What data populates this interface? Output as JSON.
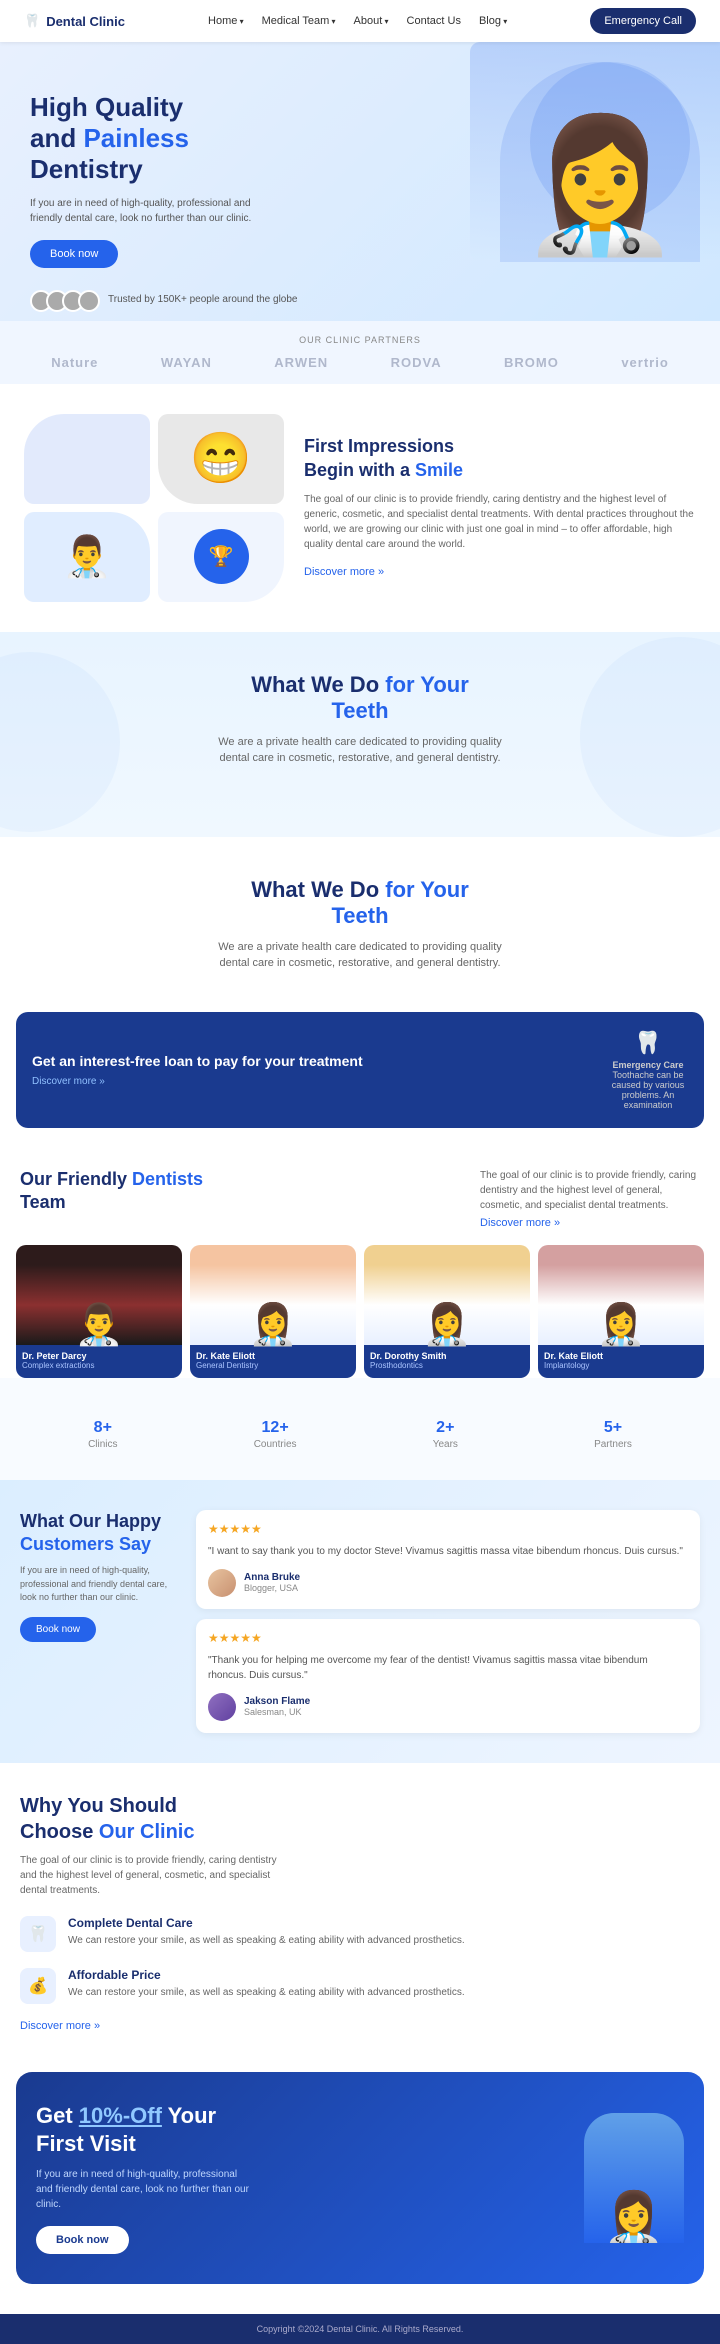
{
  "nav": {
    "logo": "Dental Clinic",
    "links": [
      "Home",
      "Medical Team",
      "About",
      "Contact Us",
      "Blog"
    ],
    "emergency": "Emergency Call"
  },
  "hero": {
    "title_line1": "High Quality",
    "title_line2": "and ",
    "title_highlight": "Painless",
    "title_line3": "Dentistry",
    "description": "If you are in need of high-quality, professional and friendly dental care, look no further than our clinic.",
    "book_btn": "Book now",
    "trusted_text": "Trusted by 150K+ people around the globe"
  },
  "partners": {
    "label": "OUR CLINIC PARTNERS",
    "logos": [
      "Nature",
      "WAYAN",
      "ARWEN",
      "RODVA",
      "BROMO",
      "vertrio"
    ]
  },
  "first_impressions": {
    "title_line1": "First Impressions",
    "title_line2": "Begin with a ",
    "title_highlight": "Smile",
    "description": "The goal of our clinic is to provide friendly, caring dentistry and the highest level of generic, cosmetic, and specialist dental treatments. With dental practices throughout the world, we are growing our clinic with just one goal in mind – to offer affordable, high quality dental care around the world.",
    "discover": "Discover more"
  },
  "what_we_do_1": {
    "title_line1": "What We Do ",
    "title_highlight1": "for Your",
    "title_line2": "Teeth",
    "description": "We are a private health care dedicated to providing quality dental care in cosmetic, restorative, and general dentistry."
  },
  "what_we_do_2": {
    "title_line1": "What We Do ",
    "title_highlight1": "for Your",
    "title_line2": "Teeth",
    "description": "We are a private health care dedicated to providing quality dental care in cosmetic, restorative, and general dentistry."
  },
  "loan": {
    "title": "Get an interest-free loan to pay for your treatment",
    "discover": "Discover more",
    "emergency_label": "Emergency Care",
    "emergency_desc": "Toothache can be caused by various problems. An examination"
  },
  "team": {
    "title_line1": "Our Friendly ",
    "title_highlight": "Dentists",
    "title_line2": "Team",
    "description": "The goal of our clinic is to provide friendly, caring dentistry and the highest level of general, cosmetic, and specialist dental treatments.",
    "discover": "Discover more",
    "doctors": [
      {
        "name": "Dr. Peter Darcy",
        "role": "Complex extractions"
      },
      {
        "name": "Dr. Kate Eliott",
        "role": "General Dentistry"
      },
      {
        "name": "Dr. Dorothy Smith",
        "role": "Prosthodontics"
      },
      {
        "name": "Dr. Kate Eliott",
        "role": "Implantology"
      }
    ]
  },
  "stats": [
    {
      "number": "8",
      "suffix": "+",
      "label": "Clinics"
    },
    {
      "number": "12",
      "suffix": "+",
      "label": "Countries"
    },
    {
      "number": "2",
      "suffix": "+",
      "label": "Years"
    },
    {
      "number": "5",
      "suffix": "+",
      "label": "Partners"
    }
  ],
  "testimonials": {
    "title_line1": "What Our Happy",
    "title_highlight": "Customers Say",
    "description": "If you are in need of high-quality, professional and friendly dental care, look no further than our clinic.",
    "book_btn": "Book now",
    "reviews": [
      {
        "stars": "★★★★★",
        "text": "\"I want to say thank you to my doctor Steve! Vivamus sagittis massa vitae bibendum rhoncus. Duis cursus.\"",
        "author": "Anna Bruke",
        "role": "Blogger, USA"
      },
      {
        "stars": "★★★★★",
        "text": "\"Thank you for helping me overcome my fear of the dentist! Vivamus sagittis massa vitae bibendum rhoncus. Duis cursus.\"",
        "author": "Jakson Flame",
        "role": "Salesman, UK"
      }
    ]
  },
  "why_choose": {
    "title_line1": "Why You Should",
    "title_line2": "Choose ",
    "title_highlight": "Our Clinic",
    "description": "The goal of our clinic is to provide friendly, caring dentistry and the highest level of general, cosmetic, and specialist dental treatments.",
    "items": [
      {
        "icon": "🦷",
        "title": "Complete Dental Care",
        "description": "We can restore your smile, as well as speaking & eating ability with advanced prosthetics."
      },
      {
        "icon": "💰",
        "title": "Affordable Price",
        "description": "We can restore your smile, as well as speaking & eating ability with advanced prosthetics."
      }
    ],
    "discover": "Discover more"
  },
  "cta": {
    "title_line1": "Get ",
    "title_highlight": "10%-Off",
    "title_line2": " Your",
    "title_line3": "First Visit",
    "description": "If you are in need of high-quality, professional and friendly dental care, look no further than our clinic.",
    "book_btn": "Book now"
  },
  "footer": {
    "copyright": "Copyright ©2024 Dental Clinic. All Rights Reserved."
  }
}
